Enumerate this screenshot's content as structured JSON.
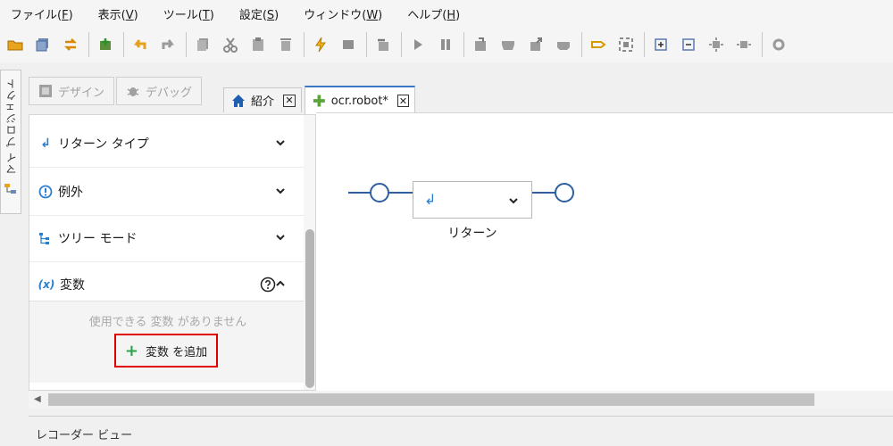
{
  "menu": [
    {
      "label": "ファイル(",
      "key": "F",
      "end": ")"
    },
    {
      "label": "表示(",
      "key": "V",
      "end": ")"
    },
    {
      "label": "ツール(",
      "key": "T",
      "end": ")"
    },
    {
      "label": "設定(",
      "key": "S",
      "end": ")"
    },
    {
      "label": "ウィンドウ(",
      "key": "W",
      "end": ")"
    },
    {
      "label": "ヘルプ(",
      "key": "H",
      "end": ")"
    }
  ],
  "side_tab": {
    "label": "マイ プロジェクト"
  },
  "mode": {
    "design": "デザイン",
    "debug": "デバッグ"
  },
  "tabs": {
    "intro": "紹介",
    "ocr": "ocr.robot*"
  },
  "panel": {
    "return_type": "リターン タイプ",
    "exception": "例外",
    "tree_mode": "ツリー モード",
    "variables": "変数",
    "variables_icon": "(x)",
    "no_variables": "使用できる 変数 がありません",
    "add_variable": "変数 を追加"
  },
  "canvas": {
    "step_label": "リターン"
  },
  "recorder": "レコーダー ビュー",
  "colors": {
    "accent": "#2f5f9e",
    "highlight": "#e00000",
    "add": "#2ca34a"
  }
}
